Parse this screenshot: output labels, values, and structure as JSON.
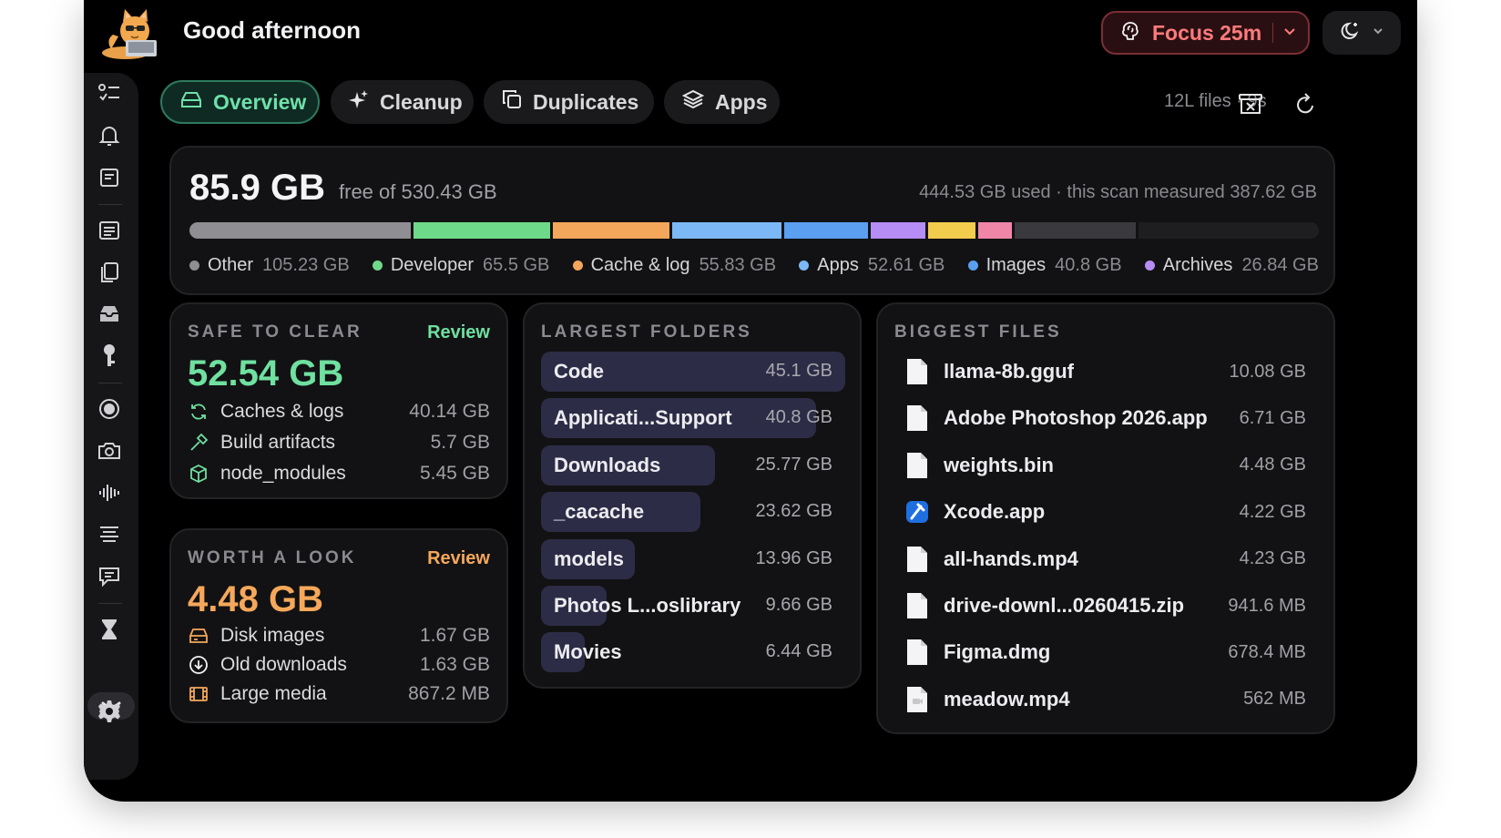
{
  "header": {
    "greeting": "Good afternoon",
    "focus_label": "Focus 25m"
  },
  "tabs": [
    {
      "label": "Overview",
      "active": true
    },
    {
      "label": "Cleanup",
      "active": false
    },
    {
      "label": "Duplicates",
      "active": false
    },
    {
      "label": "Apps",
      "active": false
    }
  ],
  "scan_meta": "12L files · 9s",
  "summary": {
    "free_value": "85.9 GB",
    "free_label": "free of 530.43 GB",
    "used_label": "444.53 GB used · this scan measured 387.62 GB",
    "segments": [
      {
        "name": "Other",
        "value_gb": 105.23,
        "color": "#8e8e93"
      },
      {
        "name": "Developer",
        "value_gb": 65.5,
        "color": "#6fd98a"
      },
      {
        "name": "Cache & log",
        "value_gb": 55.83,
        "color": "#f3a75a"
      },
      {
        "name": "Apps",
        "value_gb": 52.61,
        "color": "#7cb8f5"
      },
      {
        "name": "Images",
        "value_gb": 40.8,
        "color": "#5a9ff0"
      },
      {
        "name": "Archives",
        "value_gb": 26.84,
        "color": "#b68cf5"
      },
      {
        "name": "",
        "value_gb": 23.5,
        "color": "#f2cc4c"
      },
      {
        "name": "",
        "value_gb": 17.3,
        "color": "#ef86a8"
      },
      {
        "name": "",
        "value_gb": 58.0,
        "color": "#3a3a3e"
      }
    ],
    "total_gb": 530.43,
    "legend": [
      {
        "name": "Other",
        "value": "105.23 GB",
        "color": "#8e8e93"
      },
      {
        "name": "Developer",
        "value": "65.5 GB",
        "color": "#6fd98a"
      },
      {
        "name": "Cache & log",
        "value": "55.83 GB",
        "color": "#f3a75a"
      },
      {
        "name": "Apps",
        "value": "52.61 GB",
        "color": "#7cb8f5"
      },
      {
        "name": "Images",
        "value": "40.8 GB",
        "color": "#5a9ff0"
      },
      {
        "name": "Archives",
        "value": "26.84 GB",
        "color": "#b68cf5"
      }
    ]
  },
  "safe_to_clear": {
    "title": "SAFE TO CLEAR",
    "action": "Review",
    "total": "52.54 GB",
    "accent": "#6fe0a0",
    "items": [
      {
        "name": "Caches & logs",
        "value": "40.14 GB",
        "icon": "refresh-icon"
      },
      {
        "name": "Build artifacts",
        "value": "5.7 GB",
        "icon": "hammer-icon"
      },
      {
        "name": "node_modules",
        "value": "5.45 GB",
        "icon": "package-icon"
      }
    ]
  },
  "worth_a_look": {
    "title": "WORTH A LOOK",
    "action": "Review",
    "total": "4.48 GB",
    "accent": "#f5a85a",
    "items": [
      {
        "name": "Disk images",
        "value": "1.67 GB",
        "icon": "disk-icon"
      },
      {
        "name": "Old downloads",
        "value": "1.63 GB",
        "icon": "download-icon"
      },
      {
        "name": "Large media",
        "value": "867.2 MB",
        "icon": "film-icon"
      }
    ]
  },
  "largest_folders": {
    "title": "LARGEST FOLDERS",
    "items": [
      {
        "name": "Code",
        "value": "45.1 GB",
        "size_gb": 45.1
      },
      {
        "name": "Applicati...Support",
        "value": "40.8 GB",
        "size_gb": 40.8
      },
      {
        "name": "Downloads",
        "value": "25.77 GB",
        "size_gb": 25.77
      },
      {
        "name": "_cacache",
        "value": "23.62 GB",
        "size_gb": 23.62
      },
      {
        "name": "models",
        "value": "13.96 GB",
        "size_gb": 13.96
      },
      {
        "name": "Photos L...oslibrary",
        "value": "9.66 GB",
        "size_gb": 9.66
      },
      {
        "name": "Movies",
        "value": "6.44 GB",
        "size_gb": 6.44
      }
    ]
  },
  "biggest_files": {
    "title": "BIGGEST FILES",
    "items": [
      {
        "name": "llama-8b.gguf",
        "value": "10.08 GB",
        "icon": "file-icon"
      },
      {
        "name": "Adobe Photoshop 2026.app",
        "value": "6.71 GB",
        "icon": "file-icon"
      },
      {
        "name": "weights.bin",
        "value": "4.48 GB",
        "icon": "file-icon"
      },
      {
        "name": "Xcode.app",
        "value": "4.22 GB",
        "icon": "xcode-icon"
      },
      {
        "name": "all-hands.mp4",
        "value": "4.23 GB",
        "icon": "file-icon"
      },
      {
        "name": "drive-downl...0260415.zip",
        "value": "941.6 MB",
        "icon": "file-icon"
      },
      {
        "name": "Figma.dmg",
        "value": "678.4 MB",
        "icon": "file-icon"
      },
      {
        "name": "meadow.mp4",
        "value": "562 MB",
        "icon": "video-file-icon"
      }
    ]
  },
  "sidebar_icons": [
    "checklist-icon",
    "bell-icon",
    "notes-icon",
    "list-icon",
    "documents-icon",
    "tray-icon",
    "key-icon",
    "record-icon",
    "camera-icon",
    "waveform-icon",
    "text-lines-icon",
    "chat-icon",
    "hourglass-icon",
    "collapse-icon",
    "gear-icon"
  ]
}
